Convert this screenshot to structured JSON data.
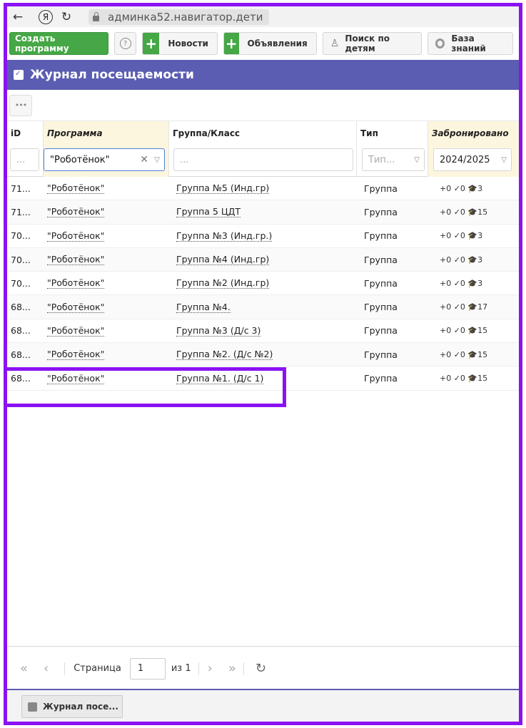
{
  "browser": {
    "url": "админка52.навигатор.дети"
  },
  "toolbar": {
    "create_label": "Создать программу",
    "help_label": "?",
    "news_label": "Новости",
    "ads_label": "Объявления",
    "search_children_label": "Поиск по детям",
    "knowledge_label": "База знаний"
  },
  "header": {
    "title": "Журнал посещаемости"
  },
  "grid": {
    "menu_label": "•••",
    "columns": {
      "id": "iD",
      "program": "Программа",
      "group": "Группа/Класс",
      "type": "Тип",
      "booked": "Забронировано"
    },
    "filters": {
      "id": "...",
      "program": "\"Роботёнок\"",
      "group": "...",
      "type": "Тип...",
      "booked": "2024/2025"
    },
    "rows": [
      {
        "id": "71...",
        "program": "\"Роботёнок\"",
        "group": "Группа №5 (Инд.гр)",
        "type": "Группа",
        "booked": "+0  ✓0  🎓3"
      },
      {
        "id": "71...",
        "program": "\"Роботёнок\"",
        "group": "Группа 5 ЦДТ",
        "type": "Группа",
        "booked": "+0  ✓0  🎓15"
      },
      {
        "id": "70...",
        "program": "\"Роботёнок\"",
        "group": "Группа №3 (Инд.гр.)",
        "type": "Группа",
        "booked": "+0  ✓0  🎓3"
      },
      {
        "id": "70...",
        "program": "\"Роботёнок\"",
        "group": "Группа №4 (Инд.гр)",
        "type": "Группа",
        "booked": "+0  ✓0  🎓3"
      },
      {
        "id": "70...",
        "program": "\"Роботёнок\"",
        "group": "Группа №2 (Инд.гр)",
        "type": "Группа",
        "booked": "+0  ✓0  🎓3"
      },
      {
        "id": "68...",
        "program": "\"Роботёнок\"",
        "group": "Группа №4.",
        "type": "Группа",
        "booked": "+0  ✓0  🎓17"
      },
      {
        "id": "68...",
        "program": "\"Роботёнок\"",
        "group": "Группа №3 (Д/с 3)",
        "type": "Группа",
        "booked": "+0  ✓0  🎓15"
      },
      {
        "id": "68...",
        "program": "\"Роботёнок\"",
        "group": "Группа №2. (Д/с №2)",
        "type": "Группа",
        "booked": "+0  ✓0  🎓15"
      },
      {
        "id": "68...",
        "program": "\"Роботёнок\"",
        "group": "Группа №1. (Д/с 1)",
        "type": "Группа",
        "booked": "+0  ✓0  🎓15"
      }
    ]
  },
  "pager": {
    "page_label": "Страница",
    "page_value": "1",
    "of_label": "из 1"
  },
  "taskbar": {
    "item_label": "Журнал посе..."
  },
  "colors": {
    "accent": "#5b5db2",
    "green": "#45a745",
    "highlight": "#8a12f2"
  }
}
